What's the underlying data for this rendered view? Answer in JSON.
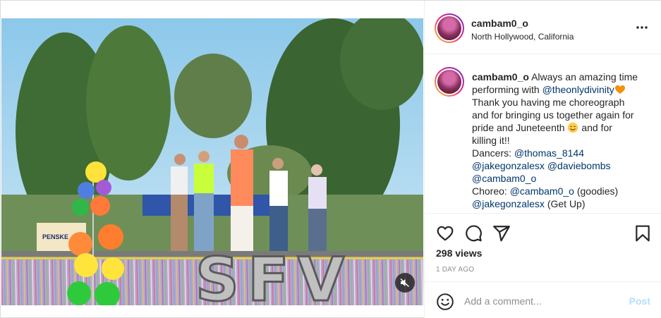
{
  "post": {
    "username": "cambam0_o",
    "location": "North Hollywood, California",
    "caption": {
      "username": "cambam0_o",
      "lines": [
        [
          {
            "t": "Always an amazing time"
          }
        ],
        [
          {
            "t": "performing with "
          },
          {
            "t": "@theonlydivinity",
            "m": true
          },
          {
            "e": "orange-heart"
          }
        ],
        [
          {
            "t": "Thank you having me choreograph"
          }
        ],
        [
          {
            "t": "and for bringing us together again for"
          }
        ],
        [
          {
            "t": "pride and Juneteenth "
          },
          {
            "e": "smiling-face"
          },
          {
            "t": " and for"
          }
        ],
        [
          {
            "t": "killing it!!"
          }
        ],
        [
          {
            "t": "Dancers: "
          },
          {
            "t": "@thomas_8144",
            "m": true
          }
        ],
        [
          {
            "t": "@jakegonzalesx",
            "m": true
          },
          {
            "t": " "
          },
          {
            "t": "@daviebombs",
            "m": true
          }
        ],
        [
          {
            "t": "@cambam0_o",
            "m": true
          }
        ],
        [
          {
            "t": "Choreo: "
          },
          {
            "t": "@cambam0_o",
            "m": true
          },
          {
            "t": " (goodies)"
          }
        ],
        [
          {
            "t": "@jakegonzalesx",
            "m": true
          },
          {
            "t": " (Get Up)"
          }
        ]
      ]
    },
    "views": "298 views",
    "age": "1 DAY AGO",
    "comment": {
      "placeholder": "Add a comment...",
      "post_label": "Post"
    },
    "media": {
      "banner_letters": "SFV",
      "truck_label": "PENSKE",
      "muted": true
    },
    "icons": {
      "more": "more-options-icon",
      "like": "heart-icon",
      "comment": "comment-icon",
      "share": "paper-plane-icon",
      "save": "bookmark-icon",
      "emoji": "smiley-icon",
      "mute": "speaker-muted-icon"
    },
    "colors": {
      "mention": "#00376b",
      "post_button": "#b2dffc",
      "meta": "#8e8e8e"
    }
  }
}
